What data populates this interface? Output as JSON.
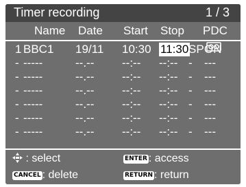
{
  "title": "Timer recording",
  "page": "1 / 3",
  "columns": {
    "name": "Name",
    "date": "Date",
    "start": "Start",
    "stop": "Stop",
    "pdc": "PDC"
  },
  "rows": [
    {
      "num": "1",
      "name": "BBC1",
      "date": "19/11",
      "start": "10:30",
      "stop": "11:30",
      "speed": "SP",
      "pdc": "ON"
    },
    {
      "num": "-",
      "name": "-----",
      "date": "--.--",
      "start": "--:--",
      "stop": "--:--",
      "speed": "-",
      "pdc": "---"
    },
    {
      "num": "-",
      "name": "-----",
      "date": "--.--",
      "start": "--:--",
      "stop": "--:--",
      "speed": "-",
      "pdc": "---"
    },
    {
      "num": "-",
      "name": "-----",
      "date": "--.--",
      "start": "--:--",
      "stop": "--:--",
      "speed": "-",
      "pdc": "---"
    },
    {
      "num": "-",
      "name": "-----",
      "date": "--.--",
      "start": "--:--",
      "stop": "--:--",
      "speed": "-",
      "pdc": "---"
    },
    {
      "num": "-",
      "name": "-----",
      "date": "--.--",
      "start": "--:--",
      "stop": "--:--",
      "speed": "-",
      "pdc": "---"
    },
    {
      "num": "-",
      "name": "-----",
      "date": "--.--",
      "start": "--:--",
      "stop": "--:--",
      "speed": "-",
      "pdc": "---"
    }
  ],
  "footer": {
    "select_label": ": select",
    "enter_key": "ENTER",
    "access_label": ": access",
    "cancel_key": "CANCEL",
    "delete_label": ": delete",
    "return_key": "RETURN",
    "return_label": ": return"
  },
  "icons": {
    "arrows": "four-way-arrow-icon",
    "tape": "cassette-icon"
  },
  "colors": {
    "background": "#6e6e6e",
    "titlebar": "#444444",
    "text": "#ffffff",
    "highlight": "#ffffff"
  }
}
